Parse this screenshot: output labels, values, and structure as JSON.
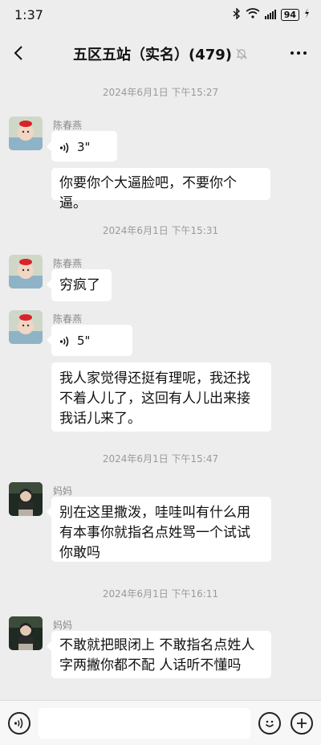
{
  "status": {
    "time": "1:37",
    "battery": "94"
  },
  "header": {
    "title": "五区五站（实名）(479)"
  },
  "messages": {
    "ts1": "2024年6月1日 下午15:27",
    "ts2": "2024年6月1日 下午15:31",
    "ts3": "2024年6月1日 下午15:47",
    "ts4": "2024年6月1日 下午16:11",
    "m1_sender": "陈春燕",
    "m1_voice": "3\"",
    "m2_text": "你要你个大逼脸吧，不要你个逼。",
    "m3_sender": "陈春燕",
    "m3_text": "穷疯了",
    "m4_sender": "陈春燕",
    "m4_voice": "5\"",
    "m5_text": "我人家觉得还挺有理呢，我还找不着人儿了，这回有人儿出来接我话儿来了。",
    "m6_sender": "妈妈",
    "m6_text": "别在这里撒泼，哇哇叫有什么用有本事你就指名点姓骂一个试试你敢吗",
    "m7_sender": "妈妈",
    "m7_text": "不敢就把眼闭上 不敢指名点姓人字两撇你都不配 人话听不懂吗"
  },
  "input": {
    "placeholder": ""
  },
  "icons": [
    "back-icon",
    "mute-bell-icon",
    "more-icon",
    "voice-wave-icon",
    "voice-toggle-icon",
    "emoji-icon",
    "plus-icon"
  ],
  "colors": {
    "background": "#ededed",
    "bubble": "#ffffff",
    "timestamp": "#9a9a9a"
  }
}
